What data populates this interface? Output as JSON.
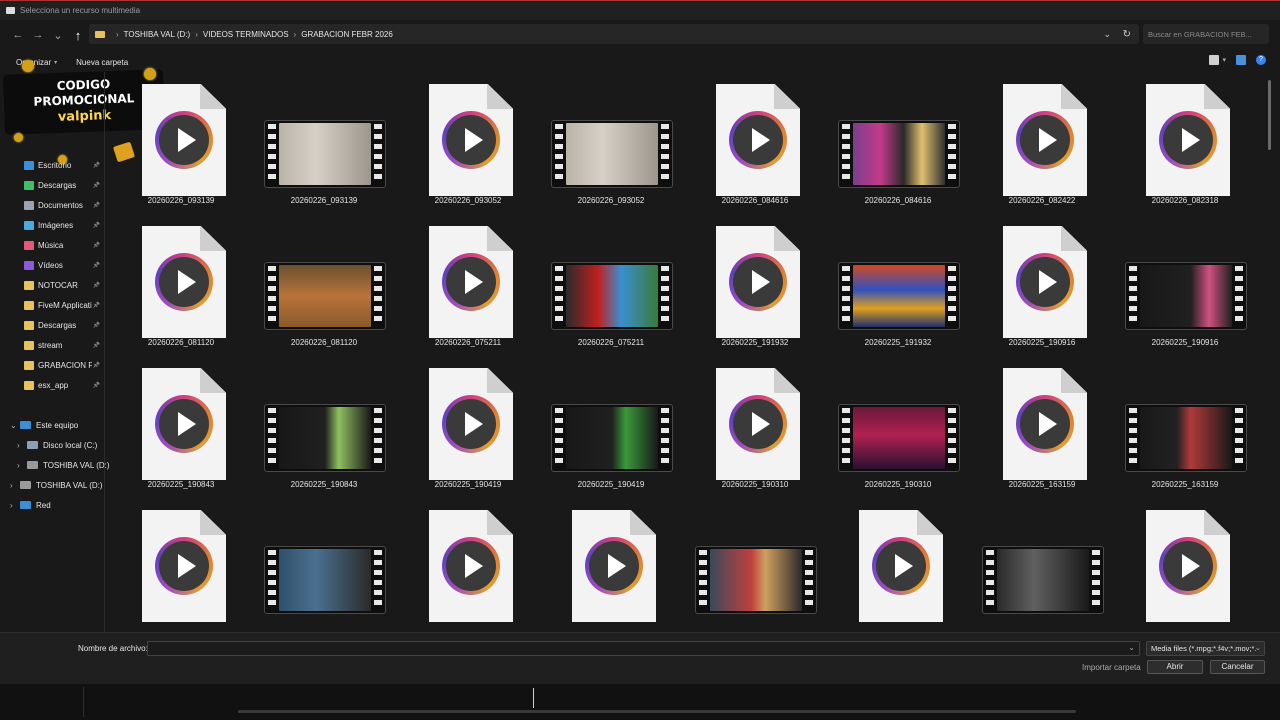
{
  "window": {
    "title": "Selecciona un recurso multimedia"
  },
  "address": {
    "crumbs": [
      "TOSHIBA VAL (D:)",
      "VIDEOS TERMINADOS",
      "GRABACION FEBR 2026"
    ],
    "search_placeholder": "Buscar en GRABACION FEB..."
  },
  "commands": {
    "organize": "Organizar",
    "new_folder": "Nueva carpeta"
  },
  "promo": {
    "line1": "CODIGO",
    "line2": "PROMOCIONAL",
    "line3": "valpink"
  },
  "sidebar": {
    "quick_access": [
      {
        "label": "Escritorio",
        "icon": "desktop-icon",
        "color": "#3b8fd9"
      },
      {
        "label": "Descargas",
        "icon": "download-icon",
        "color": "#3fbf6a"
      },
      {
        "label": "Documentos",
        "icon": "document-icon",
        "color": "#9aa4b0"
      },
      {
        "label": "Imágenes",
        "icon": "pictures-icon",
        "color": "#4aa8e0"
      },
      {
        "label": "Música",
        "icon": "music-icon",
        "color": "#e05a7a"
      },
      {
        "label": "Vídeos",
        "icon": "videos-icon",
        "color": "#8a5ad9"
      },
      {
        "label": "NOTOCAR",
        "icon": "folder-icon",
        "color": "#e6c35c"
      },
      {
        "label": "FiveM Applicatio",
        "icon": "folder-icon",
        "color": "#e6c35c"
      },
      {
        "label": "Descargas",
        "icon": "folder-icon",
        "color": "#e6c35c"
      },
      {
        "label": "stream",
        "icon": "folder-icon",
        "color": "#e6c35c"
      },
      {
        "label": "GRABACION FEB",
        "icon": "folder-icon",
        "color": "#e6c35c"
      },
      {
        "label": "esx_app",
        "icon": "folder-icon",
        "color": "#e6c35c"
      }
    ],
    "tree": [
      {
        "label": "Este equipo",
        "arrow": "⌄",
        "icon": "pc-icon",
        "color": "#3b8fd9",
        "indent": 0
      },
      {
        "label": "Disco local (C:)",
        "arrow": "›",
        "icon": "drive-icon",
        "color": "#8aa0b8",
        "indent": 1
      },
      {
        "label": "TOSHIBA VAL (D:)",
        "arrow": "›",
        "icon": "drive-icon",
        "color": "#9a9a9a",
        "indent": 1
      },
      {
        "label": "TOSHIBA VAL (D:)",
        "arrow": "›",
        "icon": "drive-icon",
        "color": "#9a9a9a",
        "indent": 0
      },
      {
        "label": "Red",
        "arrow": "›",
        "icon": "network-icon",
        "color": "#3b8fd9",
        "indent": 0
      }
    ]
  },
  "files": [
    {
      "name": "20260226_093139",
      "kind": "doc"
    },
    {
      "name": "20260226_093139",
      "kind": "film",
      "thumb": "linear-gradient(90deg,#b9b3a8,#d6d0c6 40%,#9c968c)"
    },
    {
      "name": "20260226_093052",
      "kind": "doc"
    },
    {
      "name": "20260226_093052",
      "kind": "film",
      "thumb": "linear-gradient(90deg,#b9b3a8,#d6d0c6 40%,#9c968c)"
    },
    {
      "name": "20260226_084616",
      "kind": "doc"
    },
    {
      "name": "20260226_084616",
      "kind": "film",
      "thumb": "linear-gradient(90deg,#7a3f8c,#c43a8a 30%,#2a2a2a 55%,#e0c070 75%,#303030)"
    },
    {
      "name": "20260226_082422",
      "kind": "doc"
    },
    {
      "name": "20260226_082318",
      "kind": "doc"
    },
    {
      "name": "20260226_081120",
      "kind": "doc"
    },
    {
      "name": "20260226_081120",
      "kind": "film",
      "thumb": "linear-gradient(180deg,#6a5030,#b8743a 50%,#8a5a2a)"
    },
    {
      "name": "20260226_075211",
      "kind": "doc"
    },
    {
      "name": "20260226_075211",
      "kind": "film",
      "thumb": "linear-gradient(90deg,#2a2a2a,#c02020 35%,#3a8fd0 60%,#3a7a3a)"
    },
    {
      "name": "20260225_191932",
      "kind": "doc"
    },
    {
      "name": "20260225_191932",
      "kind": "film",
      "thumb": "linear-gradient(180deg,#d04a20,#3050c0 40%,#e0a020 70%,#20306a)"
    },
    {
      "name": "20260225_190916",
      "kind": "doc"
    },
    {
      "name": "20260225_190916",
      "kind": "film",
      "thumb": "linear-gradient(90deg,#181818,#202020 55%,#d05080 75%,#202020)"
    },
    {
      "name": "20260225_190843",
      "kind": "doc"
    },
    {
      "name": "20260225_190843",
      "kind": "film",
      "thumb": "linear-gradient(90deg,#181818,#202020 50%,#90c060 65%,#181818)"
    },
    {
      "name": "20260225_190419",
      "kind": "doc"
    },
    {
      "name": "20260225_190419",
      "kind": "film",
      "thumb": "linear-gradient(90deg,#181818,#202020 50%,#3a9a3a 65%,#181818)"
    },
    {
      "name": "20260225_190310",
      "kind": "doc"
    },
    {
      "name": "20260225_190310",
      "kind": "film",
      "thumb": "linear-gradient(180deg,#6a1a3a,#b02050 45%,#2a1030)"
    },
    {
      "name": "20260225_163159",
      "kind": "doc"
    },
    {
      "name": "20260225_163159",
      "kind": "film",
      "thumb": "linear-gradient(90deg,#181818,#222 40%,#b03a3a 55%,#181818)"
    },
    {
      "name": "",
      "kind": "doc"
    },
    {
      "name": "",
      "kind": "film",
      "thumb": "linear-gradient(90deg,#30506a,#4a7090 40%,#2a2a2a)"
    },
    {
      "name": "",
      "kind": "doc"
    },
    {
      "name": "",
      "kind": "doc"
    },
    {
      "name": "",
      "kind": "film",
      "thumb": "linear-gradient(90deg,#3a4a5a,#c04040 45%,#d0a060 60%,#2a2a2a)"
    },
    {
      "name": "",
      "kind": "doc"
    },
    {
      "name": "",
      "kind": "film",
      "thumb": "linear-gradient(90deg,#2a2a2a,#606060 40%,#1a1a1a)"
    },
    {
      "name": "",
      "kind": "doc"
    }
  ],
  "footer": {
    "filename_label": "Nombre de archivo:",
    "filename_value": "",
    "filter": "Media files (*.mpg;*.f4v;*.mov;*.",
    "import_folder": "Importar carpeta",
    "open": "Abrir",
    "cancel": "Cancelar"
  }
}
